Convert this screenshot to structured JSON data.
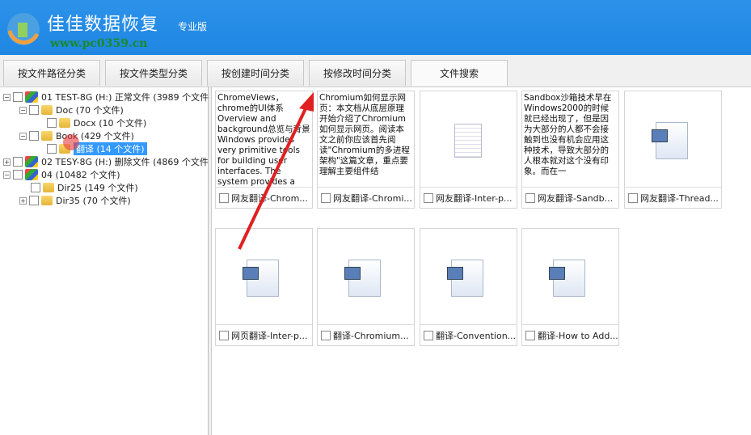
{
  "header": {
    "title": "佳佳数据恢复",
    "edition": "专业版",
    "watermark": "www.pc0359.cn"
  },
  "tabs": [
    "按文件路径分类",
    "按文件类型分类",
    "按创建时间分类",
    "按修改时间分类",
    "文件搜索"
  ],
  "tree": [
    {
      "label": "01 TEST-8G (H:) 正常文件 (3989 个文件"
    },
    {
      "label": "Doc    (70 个文件)"
    },
    {
      "label": "Docx    (10 个文件)"
    },
    {
      "label": "Book    (429 个文件)"
    },
    {
      "label": "翻译    (14 个文件)"
    },
    {
      "label": "02 TESY-8G (H:) 删除文件 (4869 个文件"
    },
    {
      "label": "04   (10482 个文件)"
    },
    {
      "label": "Dir25    (149 个文件)"
    },
    {
      "label": "Dir35    (70 个文件)"
    }
  ],
  "files": [
    {
      "name": "网友翻译-Chrom...",
      "preview": "ChromeViews，chrome的UI体系Overview and background总览与背景 Windows provides very primitive tools for building user interfaces. The system provides a few basic controls and"
    },
    {
      "name": "网友翻译-Chromi...",
      "preview": "Chromium如何显示网页：本文档从底层原理开始介绍了Chromium如何显示网页。阅读本文之前你应该首先阅读\"Chromium的多进程架构\"这篇文章，重点要理解主要组件结"
    },
    {
      "name": "网友翻译-Inter-p...",
      "preview": ""
    },
    {
      "name": "网友翻译-Sandb...",
      "preview": "Sandbox沙箱技术早在Windows2000的时候就已经出现了，但是因为大部分的人都不会接触到也没有机会应用这种技术，导致大部分的人根本就对这个没有印象。而在一"
    },
    {
      "name": "网友翻译-Thread...",
      "preview": ""
    },
    {
      "name": "网页翻译-Inter-p...",
      "preview": ""
    },
    {
      "name": "翻译-Chromium...",
      "preview": ""
    },
    {
      "name": "翻译-Convention...",
      "preview": ""
    },
    {
      "name": "翻译-How to Add...",
      "preview": ""
    }
  ],
  "colors": {
    "header": "#1f86e2",
    "selection": "#3399ff",
    "arrow": "#e02020"
  }
}
